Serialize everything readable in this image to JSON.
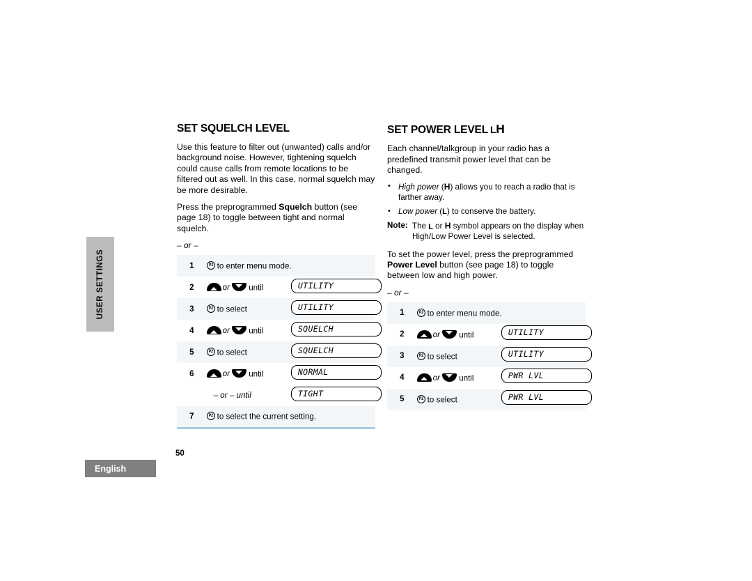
{
  "sidebar": {
    "section_tab": "USER SETTINGS",
    "language_bar": "English",
    "tab_color": "#bcbcbc",
    "lang_color": "#808080"
  },
  "footer": {
    "page_number": "50"
  },
  "left_column": {
    "heading": "SET SQUELCH LEVEL",
    "paragraphs": [
      "Use this feature to filter out (unwanted) calls and/or background noise. However, tightening squelch could cause calls from remote locations to be filtered out as well. In this case, normal squelch may be more desirable."
    ],
    "press_text_1": "Press the preprogrammed ",
    "press_bold": "Squelch",
    "press_text_2": " button (see page 18) to toggle between tight and normal squelch.",
    "or_separator": "– or –",
    "steps": [
      {
        "num": "1",
        "icon": "p2-button-icon",
        "action": "to enter menu mode.",
        "lcd": ""
      },
      {
        "num": "2",
        "icon": "up-down-arrows",
        "action_pre": "or",
        "action": "until",
        "lcd": "UTILITY"
      },
      {
        "num": "3",
        "icon": "p2-button-icon",
        "action": "to select",
        "lcd": "UTILITY"
      },
      {
        "num": "4",
        "icon": "up-down-arrows",
        "action_pre": "or",
        "action": "until",
        "lcd": "SQUELCH"
      },
      {
        "num": "5",
        "icon": "p2-button-icon",
        "action": "to select",
        "lcd": "SQUELCH"
      },
      {
        "num": "6",
        "icon": "up-down-arrows",
        "action_pre": "or",
        "action": "until",
        "lcd": "NORMAL"
      },
      {
        "num": "",
        "icon": "none",
        "action": "– or – until",
        "lcd": "TIGHT"
      },
      {
        "num": "7",
        "icon": "p2-button-icon",
        "action": "to select the current setting.",
        "lcd": ""
      }
    ],
    "table_bottom_rule_color": "#a9cde4"
  },
  "right_column": {
    "heading": "SET POWER LEVEL",
    "heading_symbol_low": "L",
    "heading_symbol_high": "H",
    "paragraphs": [
      "Each channel/talkgroup in your radio has a predefined transmit power level that can be changed."
    ],
    "bullets": [
      {
        "italic": "High power",
        "sym": "H",
        "rest": ") allows you to reach a radio that is farther away."
      },
      {
        "italic": "Low power",
        "sym": "L",
        "rest": ") to conserve the battery."
      }
    ],
    "note_label": "Note:",
    "note_pre": "The ",
    "note_sym_1": "L",
    "note_mid": " or ",
    "note_sym_2": "H",
    "note_post": " symbol appears on the display when High/Low Power Level is selected.",
    "set_text_1": "To set the power level, press the preprogrammed ",
    "set_bold": "Power Level",
    "set_text_2": " button (see page 18) to toggle between low and high power.",
    "or_separator": "– or –",
    "steps": [
      {
        "num": "1",
        "icon": "p2-button-icon",
        "action": "to enter menu mode.",
        "lcd": ""
      },
      {
        "num": "2",
        "icon": "up-down-arrows",
        "action_pre": "or",
        "action": "until",
        "lcd": "UTILITY"
      },
      {
        "num": "3",
        "icon": "p2-button-icon",
        "action": "to select",
        "lcd": "UTILITY"
      },
      {
        "num": "4",
        "icon": "up-down-arrows",
        "action_pre": "or",
        "action": "until",
        "lcd": "PWR LVL"
      },
      {
        "num": "5",
        "icon": "p2-button-icon",
        "action": "to select",
        "lcd": "PWR LVL"
      }
    ]
  }
}
